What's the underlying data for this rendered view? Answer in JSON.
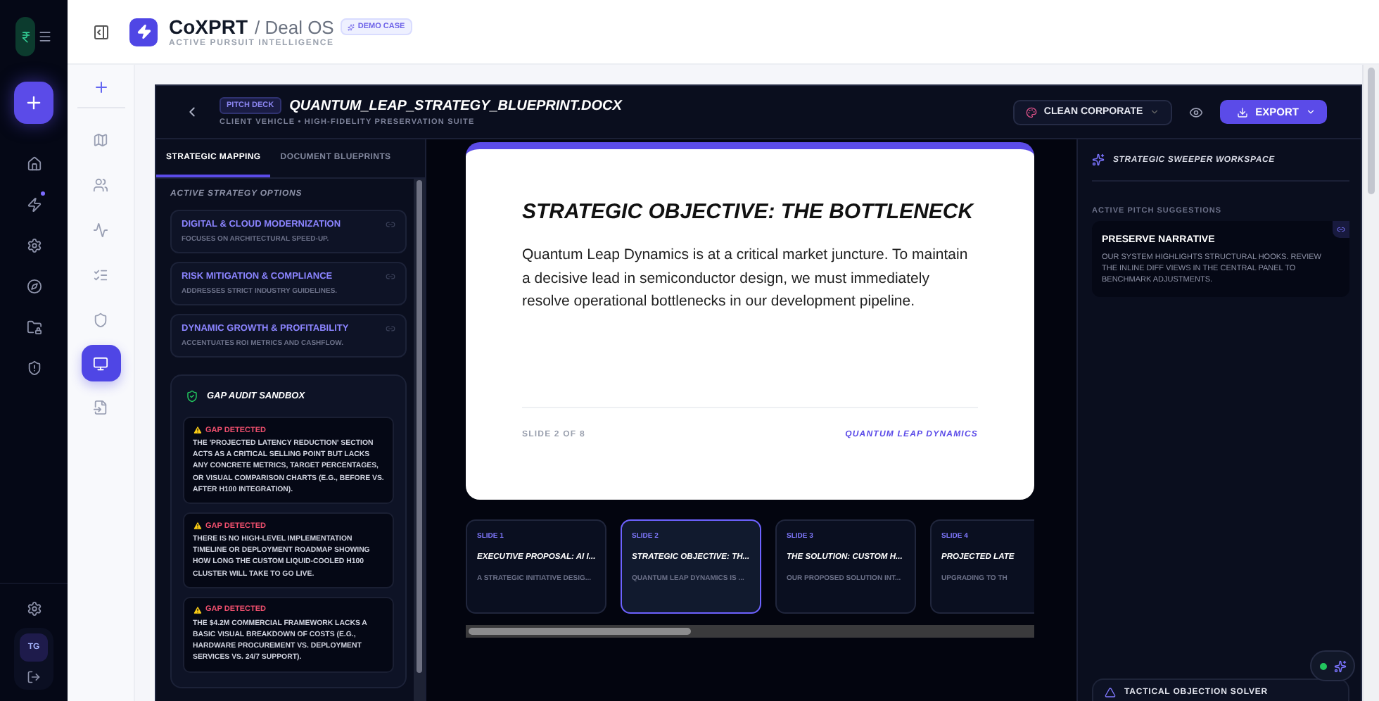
{
  "app": {
    "brand": "CoXPRT",
    "product": "/ Deal OS",
    "tagline": "ACTIVE PURSUIT INTELLIGENCE",
    "badge": "DEMO CASE"
  },
  "main_rail": {
    "items": [
      {
        "selected": false,
        "dot": false
      },
      {
        "selected": false,
        "dot": true
      },
      {
        "selected": false,
        "dot": false
      },
      {
        "selected": false,
        "dot": false
      },
      {
        "selected": false,
        "dot": false
      },
      {
        "selected": false,
        "dot": false
      }
    ],
    "avatar": "TG"
  },
  "sub_rail": {
    "items": [
      {
        "selected": false
      },
      {
        "selected": false
      },
      {
        "selected": false
      },
      {
        "selected": false
      },
      {
        "selected": false
      },
      {
        "selected": true
      },
      {
        "selected": false
      }
    ]
  },
  "document": {
    "badge": "PITCH DECK",
    "title": "QUANTUM_LEAP_STRATEGY_BLUEPRINT.DOCX",
    "subtitle": "CLIENT VEHICLE • HIGH-FIDELITY PRESERVATION SUITE",
    "theme": "CLEAN CORPORATE",
    "export": "EXPORT"
  },
  "tabs": [
    {
      "label": "STRATEGIC MAPPING",
      "selected": true
    },
    {
      "label": "DOCUMENT BLUEPRINTS",
      "selected": false
    }
  ],
  "strategy_label": "ACTIVE STRATEGY OPTIONS",
  "strategies": [
    {
      "title": "DIGITAL & CLOUD MODERNIZATION",
      "desc": "FOCUSES ON ARCHITECTURAL SPEED-UP."
    },
    {
      "title": "RISK MITIGATION & COMPLIANCE",
      "desc": "ADDRESSES STRICT INDUSTRY GUIDELINES."
    },
    {
      "title": "DYNAMIC GROWTH & PROFITABILITY",
      "desc": "ACCENTUATES ROI METRICS AND CASHFLOW."
    }
  ],
  "gap_audit": {
    "title": "GAP AUDIT SANDBOX",
    "gaps": [
      {
        "label": "GAP DETECTED",
        "text": "THE 'PROJECTED LATENCY REDUCTION' SECTION ACTS AS A CRITICAL SELLING POINT BUT LACKS ANY CONCRETE METRICS, TARGET PERCENTAGES, OR VISUAL COMPARISON CHARTS (E.G., BEFORE VS. AFTER H100 INTEGRATION)."
      },
      {
        "label": "GAP DETECTED",
        "text": "THERE IS NO HIGH-LEVEL IMPLEMENTATION TIMELINE OR DEPLOYMENT ROADMAP SHOWING HOW LONG THE CUSTOM LIQUID-COOLED H100 CLUSTER WILL TAKE TO GO LIVE."
      },
      {
        "label": "GAP DETECTED",
        "text": "THE $4.2M COMMERCIAL FRAMEWORK LACKS A BASIC VISUAL BREAKDOWN OF COSTS (E.G., HARDWARE PROCUREMENT VS. DEPLOYMENT SERVICES VS. 24/7 SUPPORT)."
      }
    ]
  },
  "slide_preview": {
    "title": "STRATEGIC OBJECTIVE: THE BOTTLENECK",
    "body": "Quantum Leap Dynamics is at a critical market juncture. To maintain a decisive lead in semiconductor design, we must immediately resolve operational bottlenecks in our development pipeline.",
    "position": "SLIDE 2 OF 8",
    "client": "QUANTUM LEAP DYNAMICS"
  },
  "slides": [
    {
      "label": "SLIDE 1",
      "title": "EXECUTIVE PROPOSAL: AI I...",
      "snippet": "A STRATEGIC INITIATIVE DESIG...",
      "selected": false
    },
    {
      "label": "SLIDE 2",
      "title": "STRATEGIC OBJECTIVE: TH...",
      "snippet": "QUANTUM LEAP DYNAMICS IS ...",
      "selected": true
    },
    {
      "label": "SLIDE 3",
      "title": "THE SOLUTION: CUSTOM H...",
      "snippet": "OUR PROPOSED SOLUTION INT...",
      "selected": false
    },
    {
      "label": "SLIDE 4",
      "title": "PROJECTED LATE",
      "snippet": "UPGRADING TO TH",
      "selected": false
    }
  ],
  "workspace": {
    "title": "STRATEGIC SWEEPER WORKSPACE",
    "label": "ACTIVE PITCH SUGGESTIONS",
    "suggestion": {
      "title": "PRESERVE NARRATIVE",
      "text": "OUR SYSTEM HIGHLIGHTS STRUCTURAL HOOKS. REVIEW THE INLINE DIFF VIEWS IN THE CENTRAL PANEL TO BENCHMARK ADJUSTMENTS."
    },
    "solver": "TACTICAL OBJECTION SOLVER"
  }
}
